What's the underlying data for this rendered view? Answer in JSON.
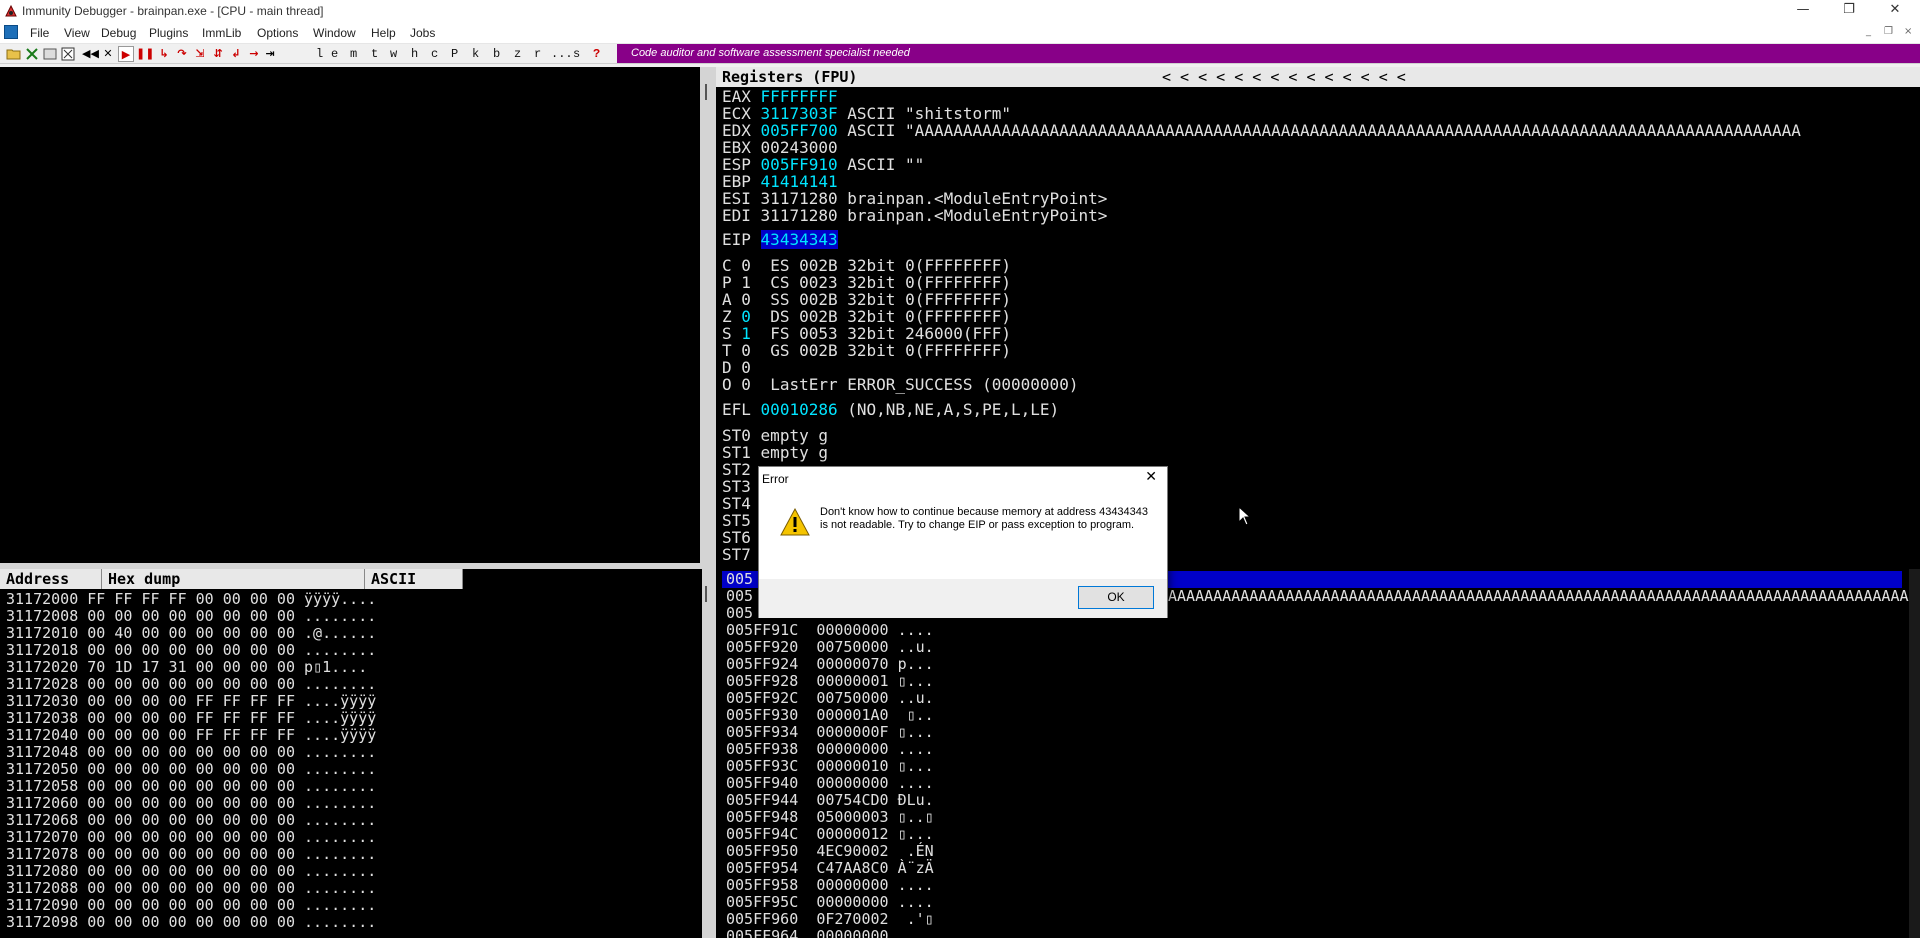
{
  "window": {
    "title": "Immunity Debugger - brainpan.exe - [CPU - main thread]",
    "minimize": "—",
    "maximize": "❐",
    "close": "✕"
  },
  "menu": {
    "items": [
      "File",
      "View",
      "Debug",
      "Plugins",
      "ImmLib",
      "Options",
      "Window",
      "Help",
      "Jobs"
    ],
    "mdi_controls": [
      "_",
      "❐",
      "×"
    ]
  },
  "toolbar": {
    "letters": [
      "l",
      "e",
      "m",
      "t",
      "w",
      "h",
      "c",
      "P",
      "k",
      "b",
      "z",
      "r",
      "...",
      "s",
      "?"
    ],
    "banner": "Code auditor and software assessment specialist needed"
  },
  "registers": {
    "header": "Registers (FPU)",
    "header_arrows": "<  <  <  <  <  <  <  <  <  <  <  <  <  <",
    "rows": [
      {
        "name": "EAX",
        "value": "FFFFFFFF",
        "info": ""
      },
      {
        "name": "ECX",
        "value": "3117303F",
        "info": "ASCII \"shitstorm\""
      },
      {
        "name": "EDX",
        "value": "005FF700",
        "info": "ASCII \"AAAAAAAAAAAAAAAAAAAAAAAAAAAAAAAAAAAAAAAAAAAAAAAAAAAAAAAAAAAAAAAAAAAAAAAAAAAAAAAAAAAAAAAAAAAA"
      },
      {
        "name": "EBX",
        "value": "00243000",
        "info": ""
      },
      {
        "name": "ESP",
        "value": "005FF910",
        "info": "ASCII \"\""
      },
      {
        "name": "EBP",
        "value": "41414141",
        "info": ""
      },
      {
        "name": "ESI",
        "value": "31171280",
        "info": "brainpan.<ModuleEntryPoint>"
      },
      {
        "name": "EDI",
        "value": "31171280",
        "info": "brainpan.<ModuleEntryPoint>"
      }
    ],
    "eip": {
      "name": "EIP",
      "value": "43434343"
    },
    "flags": [
      {
        "flag": "C",
        "val": "0",
        "seg": "ES",
        "sel": "002B",
        "desc": "32bit 0(FFFFFFFF)"
      },
      {
        "flag": "P",
        "val": "1",
        "seg": "CS",
        "sel": "0023",
        "desc": "32bit 0(FFFFFFFF)"
      },
      {
        "flag": "A",
        "val": "0",
        "seg": "SS",
        "sel": "002B",
        "desc": "32bit 0(FFFFFFFF)"
      },
      {
        "flag": "Z",
        "val": "0",
        "seg": "DS",
        "sel": "002B",
        "desc": "32bit 0(FFFFFFFF)"
      },
      {
        "flag": "S",
        "val": "1",
        "seg": "FS",
        "sel": "0053",
        "desc": "32bit 246000(FFF)"
      },
      {
        "flag": "T",
        "val": "0",
        "seg": "GS",
        "sel": "002B",
        "desc": "32bit 0(FFFFFFFF)"
      },
      {
        "flag": "D",
        "val": "0",
        "seg": "",
        "sel": "",
        "desc": ""
      },
      {
        "flag": "O",
        "val": "0",
        "seg": "LastErr",
        "sel": "",
        "desc": "ERROR_SUCCESS (00000000)"
      }
    ],
    "efl": {
      "name": "EFL",
      "value": "00010286",
      "info": "(NO,NB,NE,A,S,PE,L,LE)"
    },
    "fpu": [
      {
        "name": "ST0",
        "info": "empty g"
      },
      {
        "name": "ST1",
        "info": "empty g"
      },
      {
        "name": "ST2",
        "info": ""
      },
      {
        "name": "ST3",
        "info": ""
      },
      {
        "name": "ST4",
        "info": ""
      },
      {
        "name": "ST5",
        "info": ""
      },
      {
        "name": "ST6",
        "info": ""
      },
      {
        "name": "ST7",
        "info": ""
      }
    ]
  },
  "dump": {
    "headers": [
      "Address",
      "Hex dump",
      "ASCII"
    ],
    "rows": [
      {
        "addr": "31172000",
        "hex": "FF FF FF FF 00 00 00 00",
        "ascii": "ÿÿÿÿ...."
      },
      {
        "addr": "31172008",
        "hex": "00 00 00 00 00 00 00 00",
        "ascii": "........"
      },
      {
        "addr": "31172010",
        "hex": "00 40 00 00 00 00 00 00",
        "ascii": ".@......"
      },
      {
        "addr": "31172018",
        "hex": "00 00 00 00 00 00 00 00",
        "ascii": "........"
      },
      {
        "addr": "31172020",
        "hex": "70 1D 17 31 00 00 00 00",
        "ascii": "p▯1...."
      },
      {
        "addr": "31172028",
        "hex": "00 00 00 00 00 00 00 00",
        "ascii": "........"
      },
      {
        "addr": "31172030",
        "hex": "00 00 00 00 FF FF FF FF",
        "ascii": "....ÿÿÿÿ"
      },
      {
        "addr": "31172038",
        "hex": "00 00 00 00 FF FF FF FF",
        "ascii": "....ÿÿÿÿ"
      },
      {
        "addr": "31172040",
        "hex": "00 00 00 00 FF FF FF FF",
        "ascii": "....ÿÿÿÿ"
      },
      {
        "addr": "31172048",
        "hex": "00 00 00 00 00 00 00 00",
        "ascii": "........"
      },
      {
        "addr": "31172050",
        "hex": "00 00 00 00 00 00 00 00",
        "ascii": "........"
      },
      {
        "addr": "31172058",
        "hex": "00 00 00 00 00 00 00 00",
        "ascii": "........"
      },
      {
        "addr": "31172060",
        "hex": "00 00 00 00 00 00 00 00",
        "ascii": "........"
      },
      {
        "addr": "31172068",
        "hex": "00 00 00 00 00 00 00 00",
        "ascii": "........"
      },
      {
        "addr": "31172070",
        "hex": "00 00 00 00 00 00 00 00",
        "ascii": "........"
      },
      {
        "addr": "31172078",
        "hex": "00 00 00 00 00 00 00 00",
        "ascii": "........"
      },
      {
        "addr": "31172080",
        "hex": "00 00 00 00 00 00 00 00",
        "ascii": "........"
      },
      {
        "addr": "31172088",
        "hex": "00 00 00 00 00 00 00 00",
        "ascii": "........"
      },
      {
        "addr": "31172090",
        "hex": "00 00 00 00 00 00 00 00",
        "ascii": "........"
      },
      {
        "addr": "31172098",
        "hex": "00 00 00 00 00 00 00 00",
        "ascii": "........"
      }
    ]
  },
  "stack": {
    "top_rows": [
      {
        "addr": "005",
        "value": "",
        "info": ""
      },
      {
        "addr": "005",
        "value": "",
        "info": "AAAAAAAAAAAAAAAAAAAAAAAAAAAAAAAAAAAAAAAAAAAAAAAAAAAAAAAAAAAAAAAAAAAAAAAAAAAAAAAAAAAAAAAA"
      },
      {
        "addr": "005",
        "value": "",
        "info": ""
      }
    ],
    "rows": [
      {
        "addr": "005FF91C",
        "value": "00000000",
        "info": "...."
      },
      {
        "addr": "005FF920",
        "value": "00750000",
        "info": "..u."
      },
      {
        "addr": "005FF924",
        "value": "00000070",
        "info": "p..."
      },
      {
        "addr": "005FF928",
        "value": "00000001",
        "info": "▯..."
      },
      {
        "addr": "005FF92C",
        "value": "00750000",
        "info": "..u."
      },
      {
        "addr": "005FF930",
        "value": "000001A0",
        "info": " ▯.."
      },
      {
        "addr": "005FF934",
        "value": "0000000F",
        "info": "▯..."
      },
      {
        "addr": "005FF938",
        "value": "00000000",
        "info": "...."
      },
      {
        "addr": "005FF93C",
        "value": "00000010",
        "info": "▯..."
      },
      {
        "addr": "005FF940",
        "value": "00000000",
        "info": "...."
      },
      {
        "addr": "005FF944",
        "value": "00754CD0",
        "info": "ÐLu."
      },
      {
        "addr": "005FF948",
        "value": "05000003",
        "info": "▯..▯"
      },
      {
        "addr": "005FF94C",
        "value": "00000012",
        "info": "▯..."
      },
      {
        "addr": "005FF950",
        "value": "4EC90002",
        "info": " .ÉN"
      },
      {
        "addr": "005FF954",
        "value": "C47AA8C0",
        "info": "À¨zÄ"
      },
      {
        "addr": "005FF958",
        "value": "00000000",
        "info": "...."
      },
      {
        "addr": "005FF95C",
        "value": "00000000",
        "info": "...."
      },
      {
        "addr": "005FF960",
        "value": "0F270002",
        "info": " .'▯"
      },
      {
        "addr": "005FF964",
        "value": "00000000",
        "info": "...."
      }
    ]
  },
  "dialog": {
    "title": "Error",
    "close": "✕",
    "message": "Don't know how to continue because memory at address 43434343 is not readable. Try to change EIP or pass exception to program.",
    "ok": "OK"
  },
  "colors": {
    "banner": "#880088",
    "value_cyan": "#00e5ff",
    "highlight": "#0000c8",
    "pane_bg": "#000000"
  }
}
